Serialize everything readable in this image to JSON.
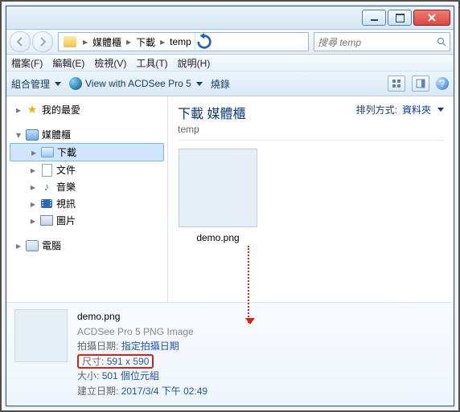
{
  "win_controls": {
    "min": "minimize",
    "max": "maximize",
    "close": "close"
  },
  "nav": {
    "breadcrumb": [
      "媒體櫃",
      "下載",
      "temp"
    ],
    "search_placeholder": "搜尋 temp"
  },
  "menubar": [
    {
      "label": "檔案(F)"
    },
    {
      "label": "編輯(E)"
    },
    {
      "label": "檢視(V)"
    },
    {
      "label": "工具(T)"
    },
    {
      "label": "說明(H)"
    }
  ],
  "toolbar": {
    "organize": "組合管理",
    "acdsee": "View with ACDSee Pro 5",
    "burn": "燒錄"
  },
  "tree": {
    "favorites": "我的最愛",
    "libraries": "媒體櫃",
    "downloads": "下載",
    "documents": "文件",
    "music": "音樂",
    "videos": "視訊",
    "pictures": "圖片",
    "computer": "電腦"
  },
  "content": {
    "heading": "下載 媒體櫃",
    "sub": "temp",
    "sort_label": "排列方式:",
    "sort_value": "資料夾",
    "file_caption": "demo.png"
  },
  "details": {
    "name": "demo.png",
    "type": "ACDSee Pro 5 PNG Image",
    "shot_date_label": "拍攝日期:",
    "shot_date_value": "指定拍攝日期",
    "dim_label": "尺寸:",
    "dim_value": "591 x 590",
    "size_label": "大小:",
    "size_value": "501 個位元組",
    "created_label": "建立日期:",
    "created_value": "2017/3/4 下午 02:49"
  }
}
